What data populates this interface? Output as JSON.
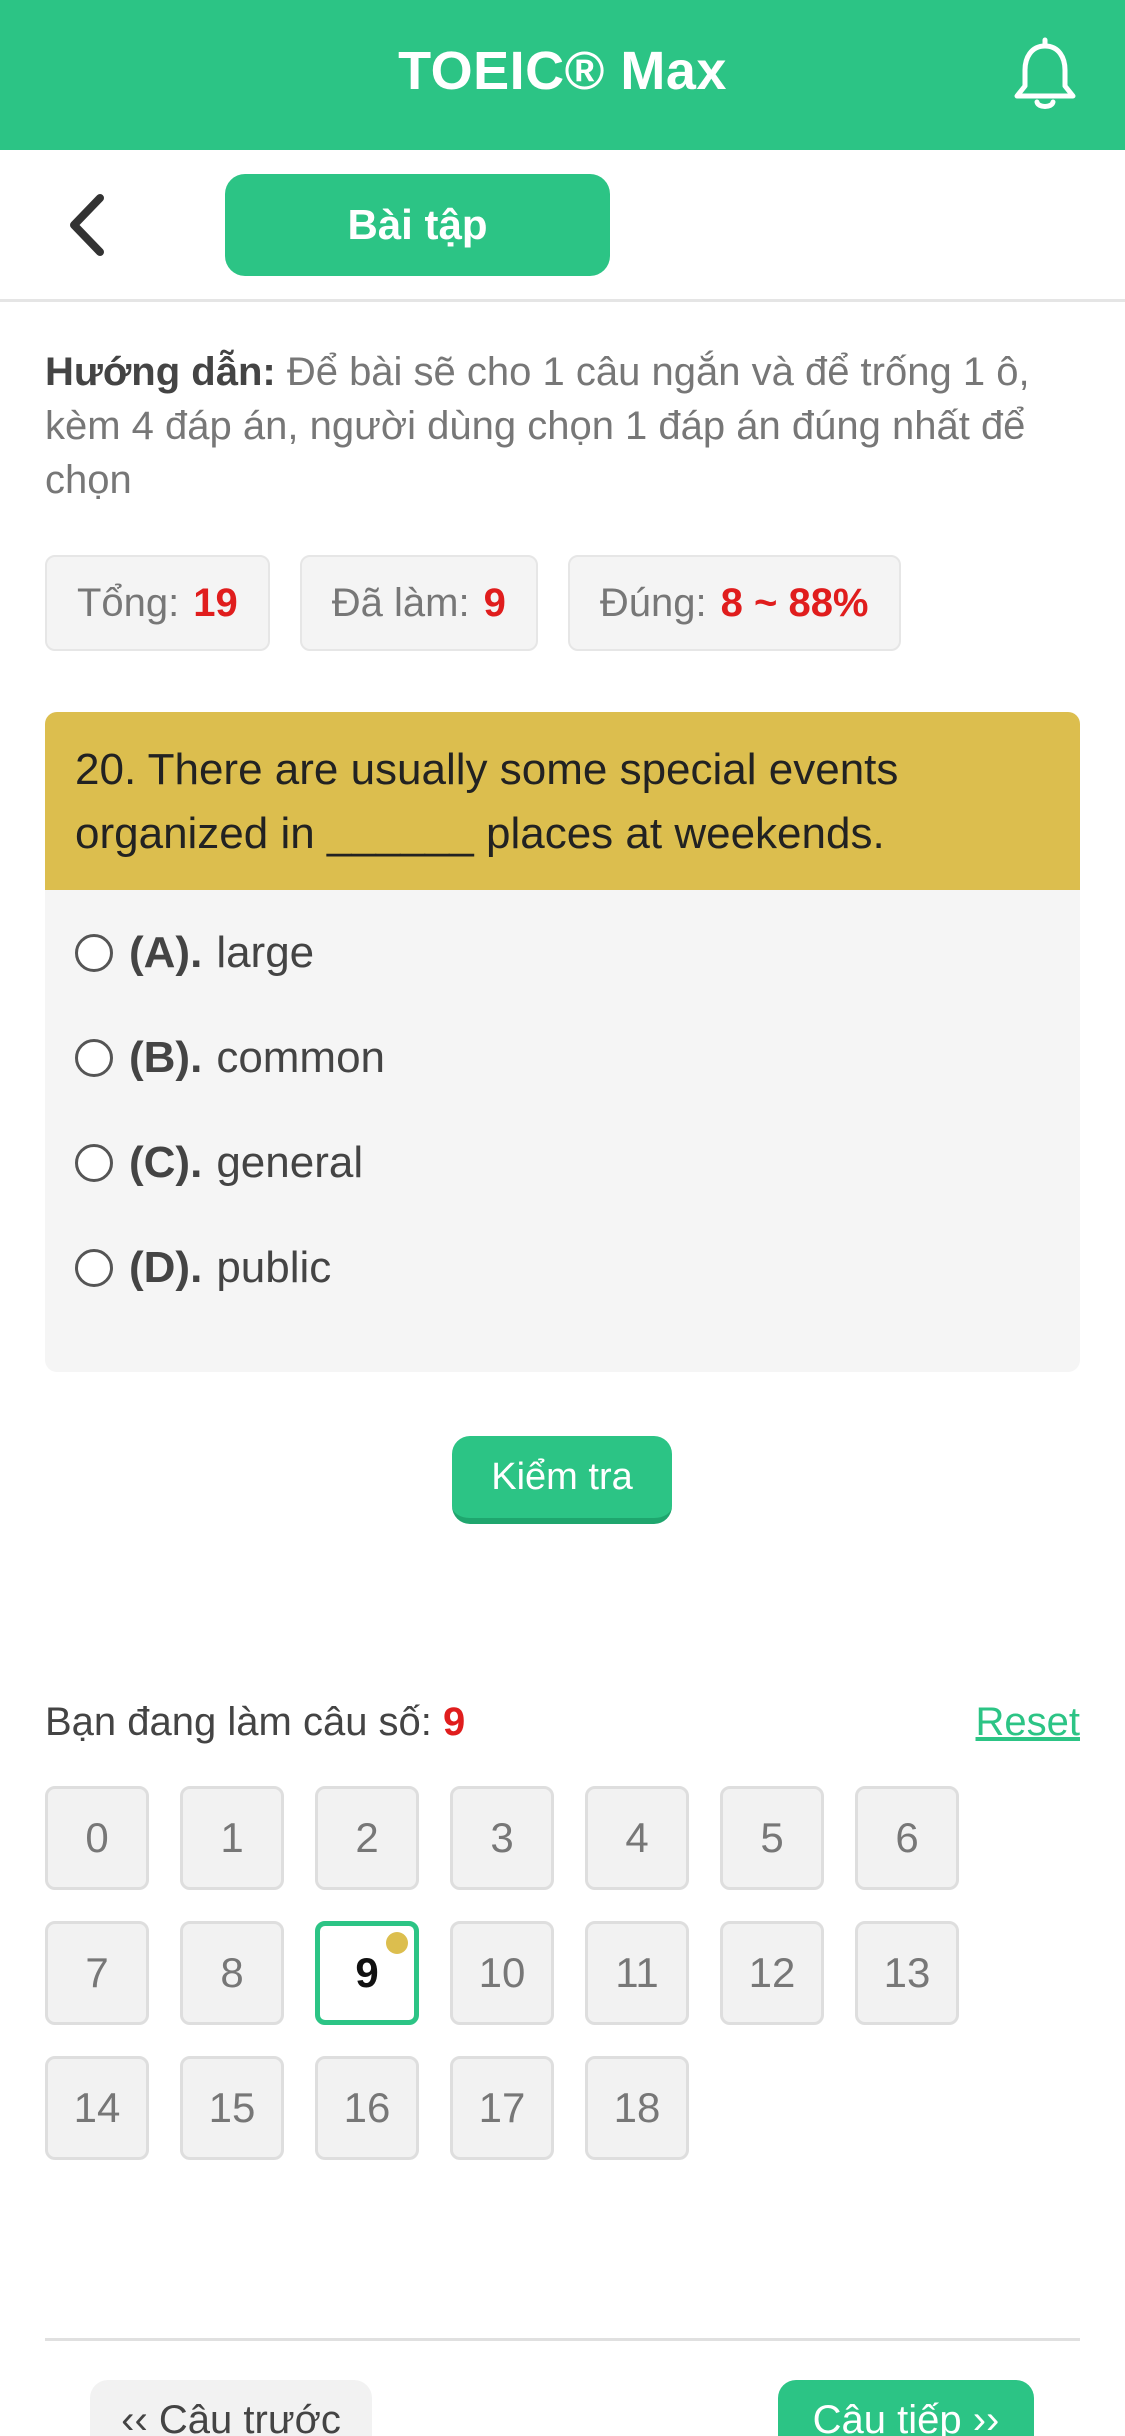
{
  "header": {
    "title": "TOEIC® Max",
    "notification_icon": "bell-icon"
  },
  "subheader": {
    "back_icon": "chevron-left-icon",
    "tab_label": "Bài tập"
  },
  "guide": {
    "label": "Hướng dẫn:",
    "text": " Để bài sẽ cho 1 câu ngắn và để trống 1 ô, kèm 4 đáp án, người dùng chọn 1 đáp án đúng nhất để chọn"
  },
  "stats": {
    "total_label": "Tổng:",
    "total_value": "19",
    "done_label": "Đã làm:",
    "done_value": "9",
    "correct_label": "Đúng:",
    "correct_value": "8 ~ 88%"
  },
  "question": {
    "text": "20. There are usually some special events organized in ______ places at weekends.",
    "options": [
      {
        "letter": "(A).",
        "text": "large"
      },
      {
        "letter": "(B).",
        "text": "common"
      },
      {
        "letter": "(C).",
        "text": "general"
      },
      {
        "letter": "(D).",
        "text": "public"
      }
    ]
  },
  "check_button": "Kiểm tra",
  "progress": {
    "label": "Bạn đang làm câu số: ",
    "current": "9",
    "reset": "Reset"
  },
  "question_numbers": [
    "0",
    "1",
    "2",
    "3",
    "4",
    "5",
    "6",
    "7",
    "8",
    "9",
    "10",
    "11",
    "12",
    "13",
    "14",
    "15",
    "16",
    "17",
    "18"
  ],
  "active_question": "9",
  "navigation": {
    "prev": "‹‹ Câu trước",
    "next": "Câu tiếp ››"
  },
  "colors": {
    "primary": "#2cc485",
    "question_header": "#dcbe4e",
    "highlight": "#e01d1d"
  }
}
